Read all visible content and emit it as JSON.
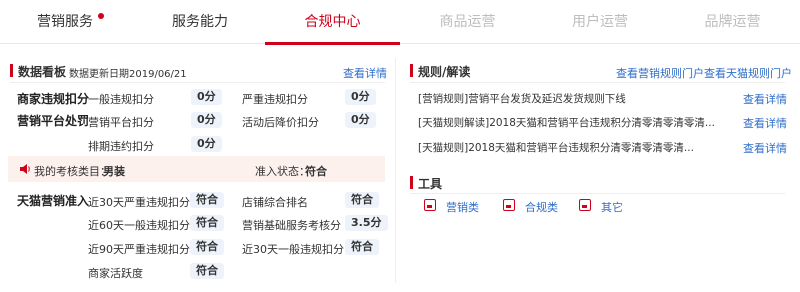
{
  "nav": {
    "tabs": [
      {
        "label": "营销服务"
      },
      {
        "label": "服务能力"
      },
      {
        "label": "合规中心"
      },
      {
        "label": "商品运营"
      },
      {
        "label": "用户运营"
      },
      {
        "label": "品牌运营"
      }
    ]
  },
  "dashboard": {
    "title": "数据看板",
    "updated": "数据更新日期2019/06/21",
    "view_detail": "查看详情",
    "penalty_label": "商家违规扣分",
    "general_label": "一般违规扣分",
    "general_value": "0分",
    "serious_label": "严重违规扣分",
    "serious_value": "0分",
    "platform_label": "营销平台处罚",
    "platform_item_label": "营销平台扣分",
    "platform_item_value": "0分",
    "activity_label": "活动后降价扣分",
    "activity_value": "0分",
    "ranking_label": "排期违约扣分",
    "ranking_value": "0分",
    "assessment_label": "我的考核类目：",
    "assessment_value": "男装",
    "admission_label": "准入状态：",
    "admission_value": "符合",
    "tmall_label": "天猫营销准入",
    "rows": [
      {
        "left_label": "近30天严重违规扣分",
        "left_value": "符合",
        "right_label": "店铺综合排名",
        "right_value": "符合"
      },
      {
        "left_label": "近60天一般违规扣分",
        "left_value": "符合",
        "right_label": "营销基础服务考核分",
        "right_value": "3.5分"
      },
      {
        "left_label": "近90天严重违规扣分",
        "left_value": "符合",
        "right_label": "近30天一般违规扣分",
        "right_value": "符合"
      },
      {
        "left_label": "商家活跃度",
        "left_value": "符合",
        "right_label": "",
        "right_value": ""
      }
    ]
  },
  "rules": {
    "title": "规则/解读",
    "link_marketing": "查看营销规则门户",
    "link_tmall": "查看天猫规则门户",
    "view_detail": "查看详情",
    "items": [
      "[营销规则]营销平台发货及延迟发货规则下线",
      "[天猫规则解读]2018天猫和营销平台违规积分清零清零清零清...",
      "[天猫规则]2018天猫和营销平台违规积分清零清零清零清..."
    ]
  },
  "tools": {
    "title": "工具",
    "items": [
      "营销类",
      "合规类",
      "其它"
    ]
  },
  "colors": {
    "accent": "#d0021b",
    "link": "#2f6dc8"
  }
}
